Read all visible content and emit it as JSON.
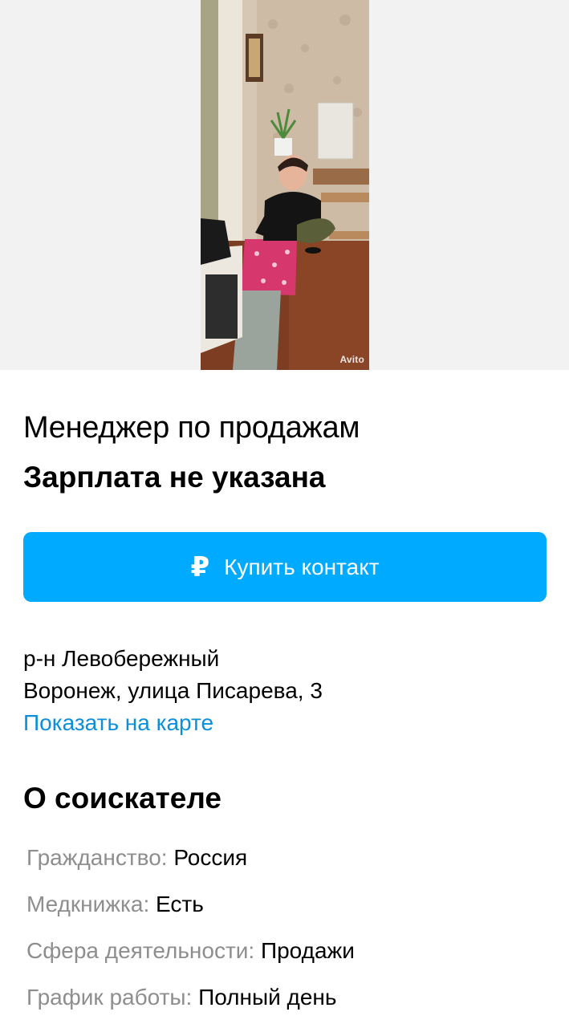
{
  "gallery": {
    "photo_alt": "",
    "watermark": "Avito"
  },
  "listing": {
    "title": "Менеджер по продажам",
    "salary": "Зарплата не указана",
    "buy_button_label": "Купить контакт",
    "buy_button_icon": "ruble-icon"
  },
  "address": {
    "district": "р-н Левобережный",
    "street": "Воронеж, улица Писарева, 3",
    "map_link": "Показать на карте"
  },
  "about": {
    "section_title": "О соискателе",
    "params": [
      {
        "label": "Гражданство:",
        "value": "Россия"
      },
      {
        "label": "Медкнижка:",
        "value": "Есть"
      },
      {
        "label": "Сфера деятельности:",
        "value": "Продажи"
      },
      {
        "label": "График работы:",
        "value": "Полный день"
      }
    ]
  },
  "colors": {
    "accent": "#00aaff",
    "link": "#0a8fd8",
    "muted": "#8e8e8e"
  }
}
